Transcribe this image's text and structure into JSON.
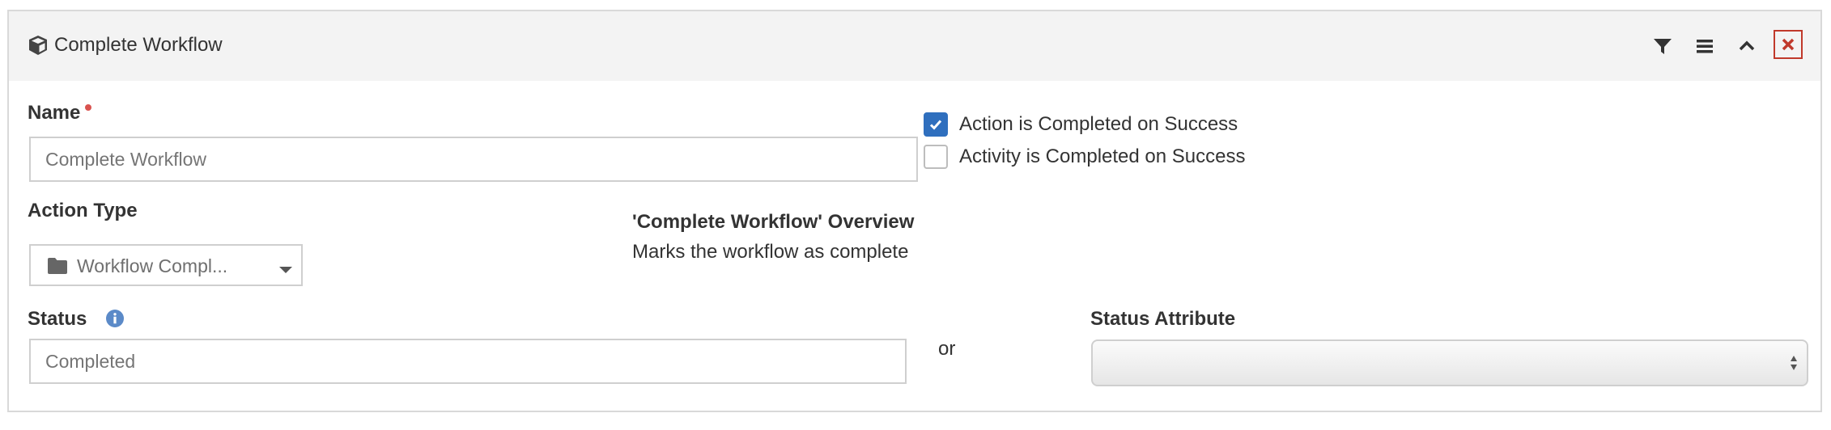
{
  "panel": {
    "title": "Complete Workflow",
    "title_icon": "cube-icon",
    "actions": [
      {
        "name": "filter",
        "icon": "filter-icon"
      },
      {
        "name": "menu",
        "icon": "bars-icon"
      },
      {
        "name": "collapse",
        "icon": "chevron-up-icon"
      },
      {
        "name": "close",
        "icon": "close-icon"
      }
    ]
  },
  "form": {
    "name": {
      "label": "Name",
      "placeholder": "Complete Workflow",
      "required": true
    },
    "action_completed": {
      "label": "Action is Completed on Success",
      "checked": true
    },
    "activity_completed": {
      "label": "Activity is Completed on Success",
      "checked": false
    },
    "action_type": {
      "label": "Action Type",
      "value": "Workflow Compl...",
      "icon": "folder-icon"
    },
    "overview": {
      "title": "'Complete Workflow' Overview",
      "text": "Marks the workflow as complete"
    },
    "status": {
      "label": "Status",
      "placeholder": "Completed",
      "info_icon": "info-icon"
    },
    "or_text": "or",
    "status_attribute": {
      "label": "Status Attribute",
      "value": ""
    }
  },
  "colors": {
    "header_bg": "#f3f3f3",
    "checkbox_checked": "#2f6fbe",
    "required": "#d9534f",
    "close": "#c0392b",
    "info": "#5b8ac8"
  }
}
